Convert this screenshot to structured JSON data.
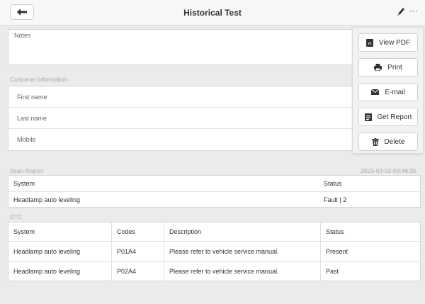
{
  "header": {
    "title": "Historical Test",
    "back_icon": "arrow-left-icon",
    "edit_icon": "pencil-icon",
    "more_label": "···"
  },
  "notes": {
    "label": "Notes"
  },
  "customer": {
    "section_label": "Customer information",
    "fields": [
      {
        "label": "First name"
      },
      {
        "label": "Last name"
      },
      {
        "label": "Mobile"
      }
    ]
  },
  "scan_report": {
    "section_label": "Scan Report",
    "timestamp": "2023-03-02 03:46:35",
    "headers": {
      "system": "System",
      "status": "Status"
    },
    "rows": [
      {
        "system": "Headlamp auto leveling",
        "status": "Fault | 2"
      }
    ]
  },
  "dtc": {
    "section_label": "DTC",
    "headers": {
      "system": "System",
      "codes": "Codes",
      "description": "Description",
      "status": "Status"
    },
    "rows": [
      {
        "system": "Headlamp auto leveling",
        "code": "P01A4",
        "description": "Please refer to vehicle service manual.",
        "status": "Present"
      },
      {
        "system": "Headlamp auto leveling",
        "code": "P02A4",
        "description": "Please refer to vehicle service manual.",
        "status": "Past"
      }
    ]
  },
  "menu": {
    "items": [
      {
        "label": "View PDF",
        "icon": "pdf-icon"
      },
      {
        "label": "Print",
        "icon": "printer-icon"
      },
      {
        "label": "E-mail",
        "icon": "mail-icon"
      },
      {
        "label": "Get Report",
        "icon": "report-icon"
      },
      {
        "label": "Delete",
        "icon": "trash-icon"
      }
    ]
  }
}
